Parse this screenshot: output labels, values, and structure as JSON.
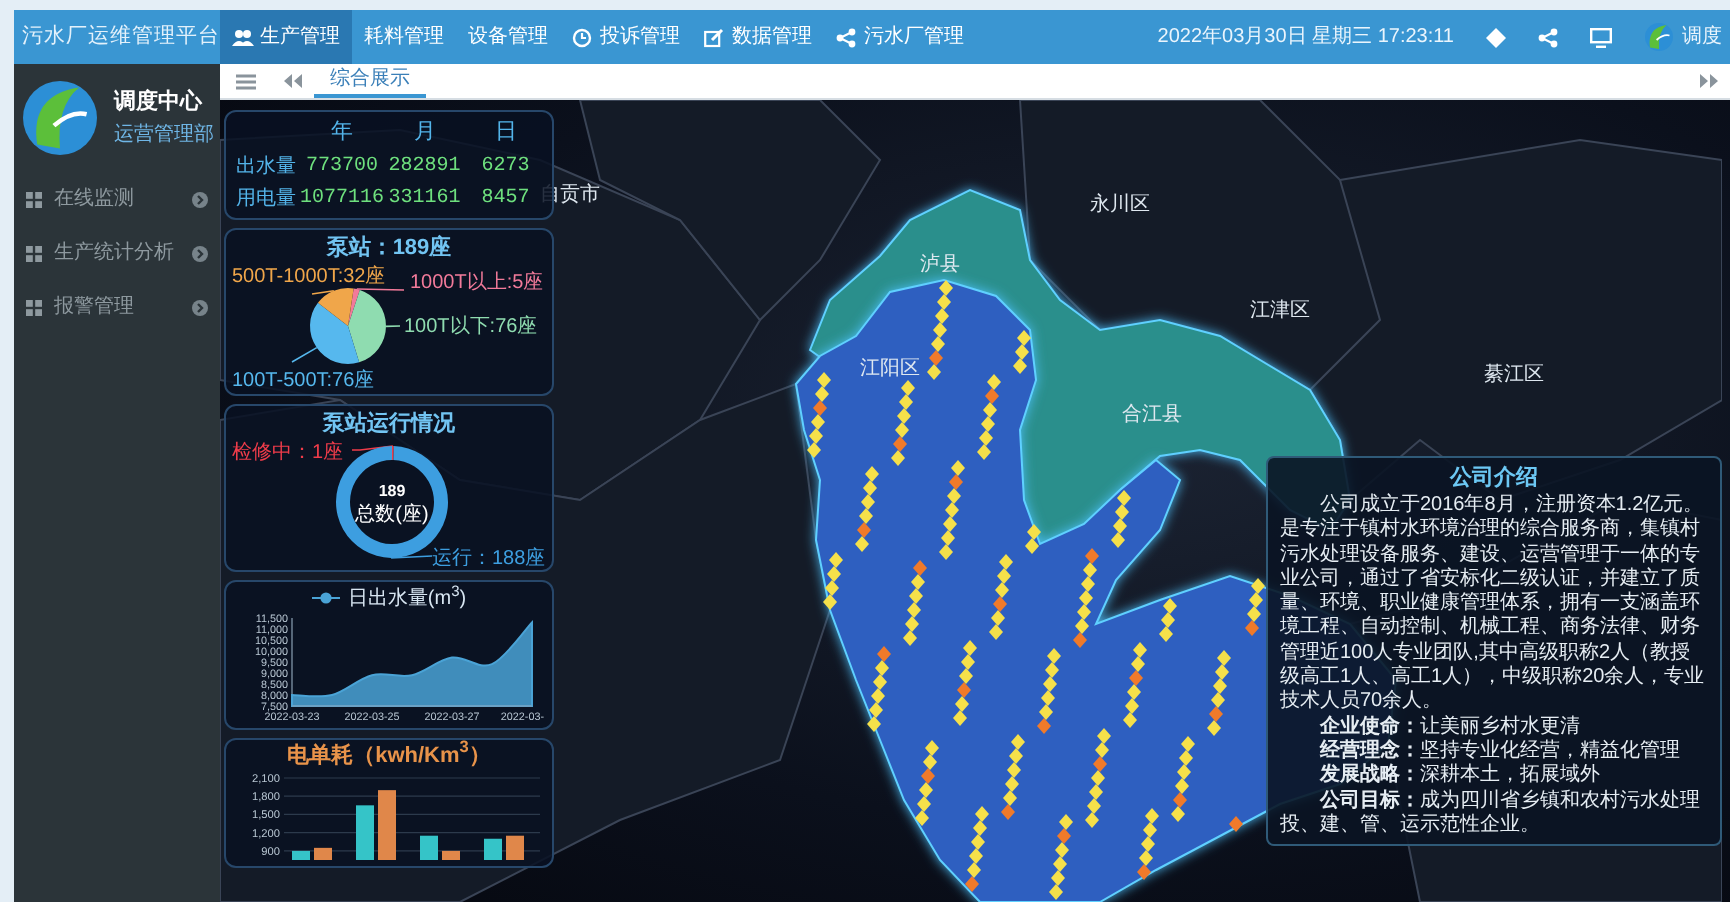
{
  "app": {
    "title": "污水厂运维管理平台"
  },
  "nav": [
    {
      "label": "生产管理",
      "selected": true,
      "with_icon": true
    },
    {
      "label": "耗料管理",
      "selected": false,
      "with_icon": false
    },
    {
      "label": "设备管理",
      "selected": false,
      "with_icon": false
    },
    {
      "label": "投诉管理",
      "selected": false,
      "with_icon": true
    },
    {
      "label": "数据管理",
      "selected": false,
      "with_icon": true
    },
    {
      "label": "污水厂管理",
      "selected": false,
      "with_icon": true
    }
  ],
  "header_right": {
    "datetime": "2022年03月30日 星期三 17:23:11",
    "user": "调度"
  },
  "profile": {
    "name": "调度中心",
    "department": "运营管理部"
  },
  "sidebar": {
    "items": [
      {
        "label": "在线监测"
      },
      {
        "label": "生产统计分析"
      },
      {
        "label": "报警管理"
      }
    ]
  },
  "tabs": [
    {
      "label": "综合展示",
      "selected": true
    }
  ],
  "production_stats": {
    "columns": [
      "年",
      "月",
      "日"
    ],
    "rows": [
      {
        "label": "出水量",
        "values": [
          "773700",
          "282891",
          "6273"
        ]
      },
      {
        "label": "用电量",
        "values": [
          "1077116",
          "331161",
          "8457"
        ]
      }
    ]
  },
  "pump_stations": {
    "chart_data": {
      "type": "pie",
      "title": "泵站：189座",
      "categories": [
        "1000T以上:5座",
        "100T以下:76座",
        "100T-500T:76座",
        "500T-1000T:32座"
      ],
      "values": [
        5,
        76,
        76,
        32
      ]
    }
  },
  "pump_status": {
    "total": "189",
    "total_label": "总数(座)",
    "chart_data": {
      "type": "donut",
      "title": "泵站运行情况",
      "categories": [
        "检修中：1座",
        "运行：188座"
      ],
      "values": [
        1,
        188
      ]
    }
  },
  "daily_outflow": {
    "chart_data": {
      "type": "area",
      "categories": [
        "2022-03-23",
        null,
        "2022-03-25",
        null,
        "2022-03-27",
        null,
        "2022-03-"
      ],
      "series": [
        {
          "name": "日出水量(m$^{3}$)",
          "color": "#4aa3d6",
          "values": [
            8000,
            8000,
            8900,
            8900,
            9700,
            9400,
            11300
          ]
        }
      ],
      "ylim": [
        7500,
        11500
      ],
      "yticks": [
        {
          "value": 7500,
          "label": "7,500"
        },
        {
          "value": 8000,
          "label": "8,000"
        },
        {
          "value": 8500,
          "label": "8,500"
        },
        {
          "value": 9000,
          "label": "9,000"
        },
        {
          "value": 9500,
          "label": "9,500"
        },
        {
          "value": 10000,
          "label": "10,000"
        },
        {
          "value": 10500,
          "label": "10,500"
        },
        {
          "value": 11000,
          "label": "11,000"
        },
        {
          "value": 11500,
          "label": "11,500"
        }
      ]
    }
  },
  "energy_use": {
    "chart_data": {
      "type": "bar",
      "title": "电单耗（kwh/Km$^{3}$）",
      "series": [
        {
          "color": "#35c4c8",
          "values": [
            900,
            1650,
            1150,
            1100
          ]
        },
        {
          "color": "#e0874a",
          "values": [
            950,
            1900,
            900,
            1150
          ]
        }
      ],
      "ylim": [
        750,
        2100
      ],
      "grid": true,
      "yticks": [
        {
          "value": 900,
          "label": "900"
        },
        {
          "value": 1200,
          "label": "1,200"
        },
        {
          "value": 1500,
          "label": "1,500"
        },
        {
          "value": 1800,
          "label": "1,800"
        },
        {
          "value": 2100,
          "label": "2,100"
        }
      ]
    }
  },
  "map_labels": [
    {
      "name": "自贡市"
    },
    {
      "name": "永川区"
    },
    {
      "name": "江津区"
    },
    {
      "name": "綦江区"
    },
    {
      "name": "泸县"
    },
    {
      "name": "合江县"
    },
    {
      "name": "江阳区"
    }
  ],
  "company_intro": {
    "title": "公司介绍",
    "paragraph": "公司成立于2016年8月，注册资本1.2亿元。是专注于镇村水环境治理的综合服务商，集镇村污水处理设备服务、建设、运营管理于一体的专业公司，通过了省安标化二级认证，并建立了质量、环境、职业健康管理体系，拥有一支涵盖环境工程、自动控制、机械工程、商务法律、财务管理近100人专业团队,其中高级职称2人（教授级高工1人、高工1人），中级职称20余人，专业技术人员70余人。",
    "items": [
      "**企业使命：**让美丽乡村水更清",
      "**经营理念：**坚持专业化经营，精益化管理",
      "**发展战略：**深耕本土，拓展域外",
      "**公司目标：**成为四川省乡镇和农村污水处理投、建、管、运示范性企业。"
    ]
  }
}
